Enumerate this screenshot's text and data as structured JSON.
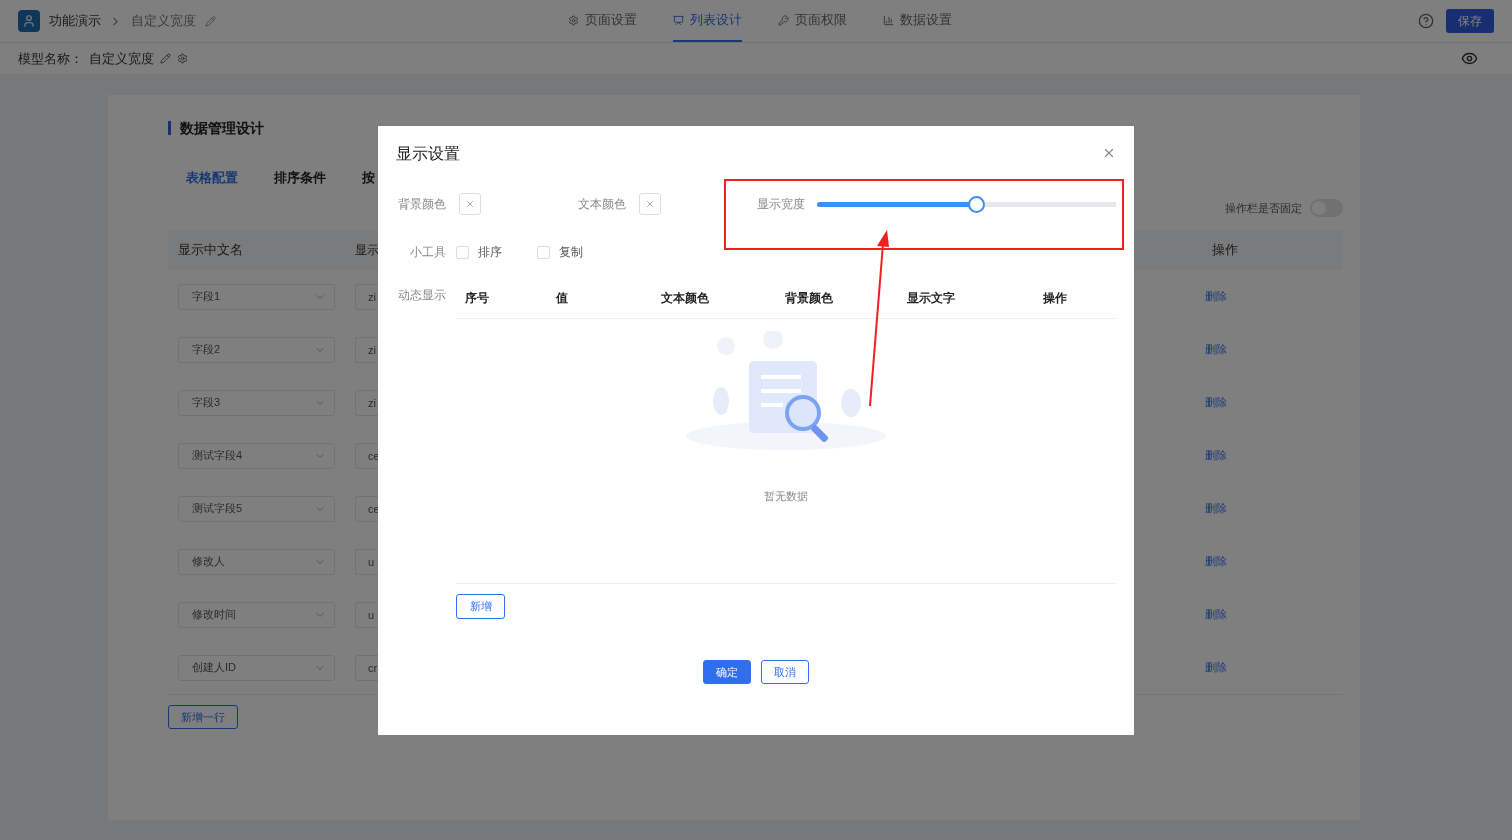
{
  "header": {
    "app": "功能演示",
    "page": "自定义宽度",
    "tabs": [
      {
        "label": "页面设置",
        "selected": false
      },
      {
        "label": "列表设计",
        "selected": true
      },
      {
        "label": "页面权限",
        "selected": false
      },
      {
        "label": "数据设置",
        "selected": false
      }
    ],
    "save": "保存"
  },
  "model_bar": {
    "label": "模型名称：",
    "value": "自定义宽度"
  },
  "designer": {
    "title": "数据管理设计",
    "tabs": [
      {
        "label": "表格配置",
        "selected": true
      },
      {
        "label": "排序条件",
        "selected": false
      },
      {
        "label": "按",
        "selected": false
      }
    ],
    "fixed_toggle": {
      "label": "操作栏是否固定",
      "on": false
    },
    "columns": [
      "显示中文名",
      "显示",
      "操作"
    ],
    "rows": [
      {
        "name": "字段1",
        "field": "zi",
        "action": "删除"
      },
      {
        "name": "字段2",
        "field": "zi",
        "action": "删除"
      },
      {
        "name": "字段3",
        "field": "zi",
        "action": "删除"
      },
      {
        "name": "测试字段4",
        "field": "ce",
        "action": "删除"
      },
      {
        "name": "测试字段5",
        "field": "ce",
        "action": "删除"
      },
      {
        "name": "修改人",
        "field": "u",
        "action": "删除"
      },
      {
        "name": "修改时间",
        "field": "u",
        "action": "删除"
      },
      {
        "name": "创建人ID",
        "field": "cr",
        "action": "删除"
      }
    ],
    "add_row": "新增一行"
  },
  "dialog": {
    "title": "显示设置",
    "bg_color_label": "背景颜色",
    "text_color_label": "文本颜色",
    "width": {
      "label": "显示宽度",
      "level": 0.53
    },
    "tools": {
      "label": "小工具",
      "options": [
        {
          "label": "排序",
          "checked": false
        },
        {
          "label": "复制",
          "checked": false
        }
      ]
    },
    "dynamic": {
      "label": "动态显示",
      "columns": [
        "序号",
        "值",
        "文本颜色",
        "背景颜色",
        "显示文字",
        "操作"
      ],
      "empty_text": "暂无数据",
      "add": "新增"
    },
    "ok": "确定",
    "cancel": "取消"
  }
}
